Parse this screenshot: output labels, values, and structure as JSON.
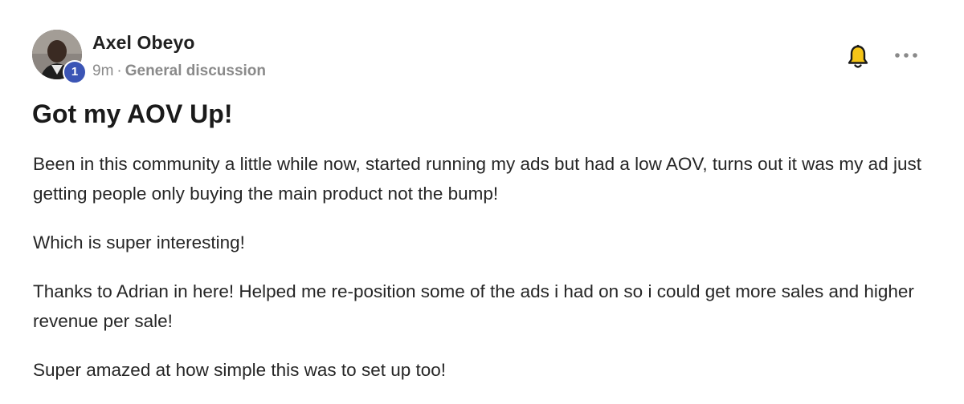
{
  "post": {
    "author": {
      "name": "Axel Obeyo",
      "level": "1"
    },
    "time_ago": "9m",
    "separator": "·",
    "category": "General discussion",
    "title": "Got my AOV Up!",
    "paragraphs": [
      "Been in this community a little while now, started running my ads but had a low AOV, turns out it was my ad just getting people only buying the main product not the bump!",
      "Which is super interesting!",
      "Thanks to Adrian in here! Helped me re-position some of the ads i had on so i could get more sales and higher revenue per sale!",
      "Super amazed at how simple this was to set up too!"
    ]
  },
  "icons": {
    "notify": "bell-icon",
    "menu": "more-options-icon"
  },
  "colors": {
    "level_badge": "#3b55b5",
    "meta_text": "#8a8a8a",
    "bell_yellow": "#f5c518"
  }
}
